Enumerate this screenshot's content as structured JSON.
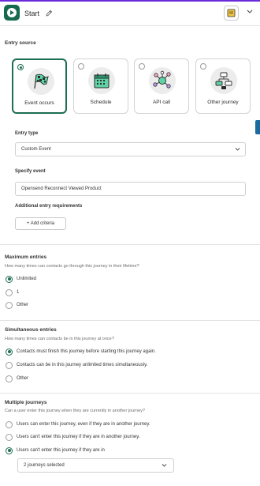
{
  "header": {
    "title": "Start"
  },
  "entry_source": {
    "heading": "Entry source",
    "cards": [
      {
        "label": "Event occurs",
        "icon": "checkered-flag-icon",
        "selected": true
      },
      {
        "label": "Schedule",
        "icon": "calendar-icon",
        "selected": false
      },
      {
        "label": "API call",
        "icon": "network-nodes-icon",
        "selected": false
      },
      {
        "label": "Other journey",
        "icon": "journey-flow-icon",
        "selected": false
      }
    ]
  },
  "entry_type": {
    "label": "Entry type",
    "value": "Custom Event"
  },
  "specify_event": {
    "label": "Specify event",
    "value": "Opensend Reconnect Viewed Product"
  },
  "additional_requirements": {
    "label": "Additional entry requirements",
    "button": "+ Add criteria"
  },
  "maximum_entries": {
    "heading": "Maximum entries",
    "description": "How many times can contacts go through this journey in their lifetime?",
    "options": [
      {
        "label": "Unlimited",
        "selected": true
      },
      {
        "label": "1",
        "selected": false
      },
      {
        "label": "Other",
        "selected": false
      }
    ]
  },
  "simultaneous_entries": {
    "heading": "Simultaneous entries",
    "description": "How many times can contacts be in this journey at once?",
    "options": [
      {
        "label": "Contacts must finish this journey before starting this journey again.",
        "selected": true
      },
      {
        "label": "Contacts can be in this journey unlimited times simultaneously.",
        "selected": false
      },
      {
        "label": "Other",
        "selected": false
      }
    ]
  },
  "multiple_journeys": {
    "heading": "Multiple journeys",
    "description": "Can a user enter this journey when they are currently in another journey?",
    "options": [
      {
        "label": "Users can enter this journey, even if they are in another journey.",
        "selected": false
      },
      {
        "label": "Users can't enter this journey if they are in another journey.",
        "selected": false
      },
      {
        "label": "Users can't enter this journey if they are in",
        "selected": true
      }
    ],
    "select_value": "2 journeys selected"
  },
  "colors": {
    "primary_green": "#166a4d",
    "accent_purple": "#6c2bd9",
    "side_tab_blue": "#1a6ba0"
  }
}
